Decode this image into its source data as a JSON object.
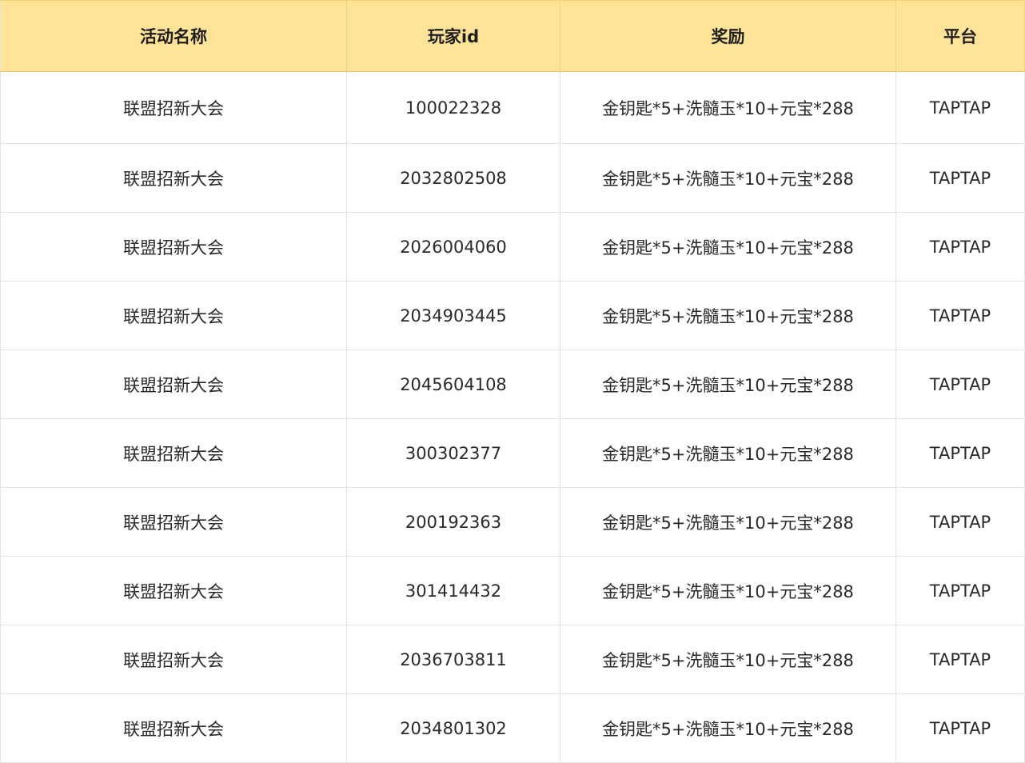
{
  "table": {
    "headers": [
      "活动名称",
      "玩家id",
      "奖励",
      "平台"
    ],
    "rows": [
      [
        "联盟招新大会",
        "100022328",
        "金钥匙*5+洗髓玉*10+元宝*288",
        "TAPTAP"
      ],
      [
        "联盟招新大会",
        "2032802508",
        "金钥匙*5+洗髓玉*10+元宝*288",
        "TAPTAP"
      ],
      [
        "联盟招新大会",
        "2026004060",
        "金钥匙*5+洗髓玉*10+元宝*288",
        "TAPTAP"
      ],
      [
        "联盟招新大会",
        "2034903445",
        "金钥匙*5+洗髓玉*10+元宝*288",
        "TAPTAP"
      ],
      [
        "联盟招新大会",
        "2045604108",
        "金钥匙*5+洗髓玉*10+元宝*288",
        "TAPTAP"
      ],
      [
        "联盟招新大会",
        "300302377",
        "金钥匙*5+洗髓玉*10+元宝*288",
        "TAPTAP"
      ],
      [
        "联盟招新大会",
        "200192363",
        "金钥匙*5+洗髓玉*10+元宝*288",
        "TAPTAP"
      ],
      [
        "联盟招新大会",
        "301414432",
        "金钥匙*5+洗髓玉*10+元宝*288",
        "TAPTAP"
      ],
      [
        "联盟招新大会",
        "2036703811",
        "金钥匙*5+洗髓玉*10+元宝*288",
        "TAPTAP"
      ],
      [
        "联盟招新大会",
        "2034801302",
        "金钥匙*5+洗髓玉*10+元宝*288",
        "TAPTAP"
      ]
    ]
  },
  "colors": {
    "header_bg": "#ffe396",
    "border": "#e3e3e3"
  }
}
